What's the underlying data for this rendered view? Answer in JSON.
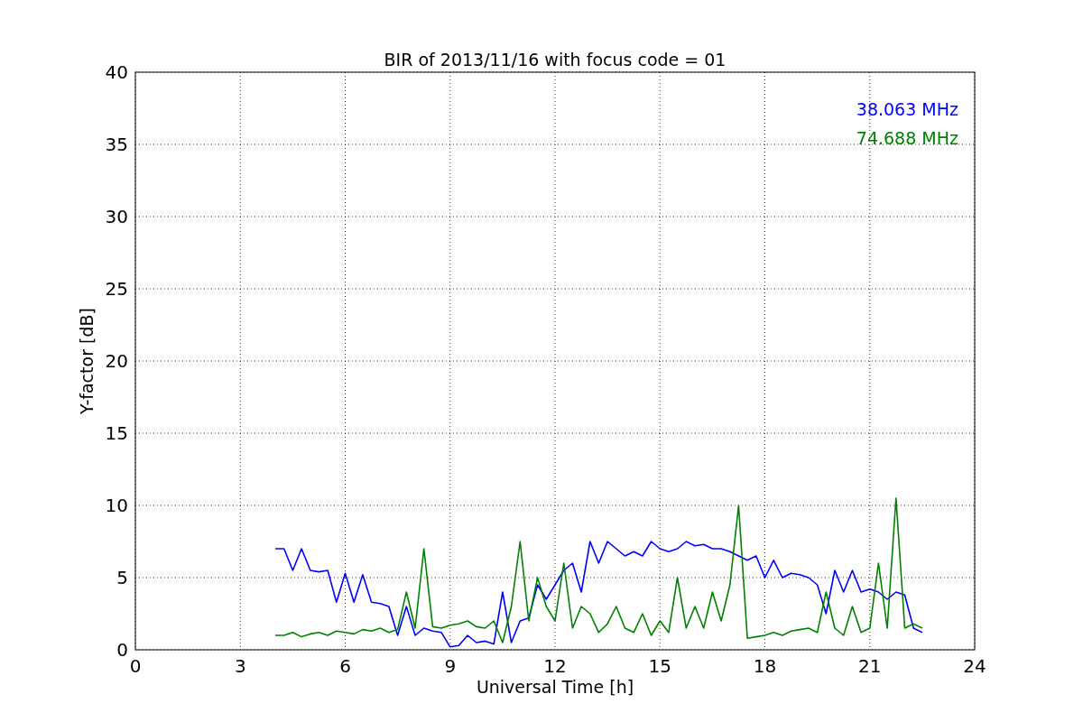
{
  "chart_data": {
    "type": "line",
    "title": "BIR of 2013/11/16 with focus code = 01",
    "xlabel": "Universal Time [h]",
    "ylabel": "Y-factor [dB]",
    "x": [
      4,
      4.25,
      4.5,
      4.75,
      5,
      5.25,
      5.5,
      5.75,
      6,
      6.25,
      6.5,
      6.75,
      7,
      7.25,
      7.5,
      7.75,
      8,
      8.25,
      8.5,
      8.75,
      9,
      9.25,
      9.5,
      9.75,
      10,
      10.25,
      10.5,
      10.75,
      11,
      11.25,
      11.5,
      11.75,
      12,
      12.25,
      12.5,
      12.75,
      13,
      13.25,
      13.5,
      13.75,
      14,
      14.25,
      14.5,
      14.75,
      15,
      15.25,
      15.5,
      15.75,
      16,
      16.25,
      16.5,
      16.75,
      17,
      17.25,
      17.5,
      17.75,
      18,
      18.25,
      18.5,
      18.75,
      19,
      19.25,
      19.5,
      19.75,
      20,
      20.25,
      20.5,
      20.75,
      21,
      21.25,
      21.5,
      21.75,
      22,
      22.25,
      22.5
    ],
    "series": [
      {
        "name": "38.063 MHz",
        "color": "#0000ff",
        "values": [
          7.0,
          7.0,
          5.5,
          7.0,
          5.5,
          5.4,
          5.5,
          3.3,
          5.3,
          3.3,
          5.2,
          3.3,
          3.2,
          3.0,
          1.0,
          3.0,
          1.0,
          1.5,
          1.3,
          1.2,
          0.2,
          0.3,
          1.0,
          0.5,
          0.6,
          0.4,
          4.0,
          0.5,
          2.0,
          2.2,
          4.5,
          3.5,
          4.5,
          5.5,
          6.0,
          4.0,
          7.5,
          6.0,
          7.5,
          7.0,
          6.5,
          6.8,
          6.5,
          7.5,
          7.0,
          6.8,
          7.0,
          7.5,
          7.2,
          7.3,
          7.0,
          7.0,
          6.8,
          6.5,
          6.2,
          6.5,
          5.0,
          6.2,
          5.0,
          5.3,
          5.2,
          5.0,
          4.5,
          2.5,
          5.5,
          4.0,
          5.5,
          4.0,
          4.2,
          4.0,
          3.5,
          4.0,
          3.8,
          1.5,
          1.2
        ]
      },
      {
        "name": "74.688 MHz",
        "color": "#008000",
        "values": [
          1.0,
          1.0,
          1.2,
          0.9,
          1.1,
          1.2,
          1.0,
          1.3,
          1.2,
          1.1,
          1.4,
          1.3,
          1.5,
          1.2,
          1.4,
          4.0,
          1.5,
          7.0,
          1.6,
          1.5,
          1.7,
          1.8,
          2.0,
          1.6,
          1.5,
          2.0,
          0.5,
          3.0,
          7.5,
          2.0,
          5.0,
          3.0,
          2.0,
          6.0,
          1.5,
          3.0,
          2.5,
          1.2,
          1.8,
          3.0,
          1.5,
          1.2,
          2.5,
          1.0,
          2.0,
          1.2,
          5.0,
          1.5,
          3.0,
          1.5,
          4.0,
          2.0,
          4.5,
          10.0,
          0.8,
          0.9,
          1.0,
          1.2,
          1.0,
          1.3,
          1.4,
          1.5,
          1.2,
          4.0,
          1.5,
          1.0,
          3.0,
          1.2,
          1.5,
          6.0,
          1.5,
          10.5,
          1.5,
          1.8,
          1.5
        ]
      }
    ],
    "grid": true,
    "xlim": [
      0,
      24
    ],
    "ylim": [
      0,
      40
    ],
    "xticks": [
      0,
      3,
      6,
      9,
      12,
      15,
      18,
      21,
      24
    ],
    "yticks": [
      0,
      5,
      10,
      15,
      20,
      25,
      30,
      35,
      40
    ]
  }
}
